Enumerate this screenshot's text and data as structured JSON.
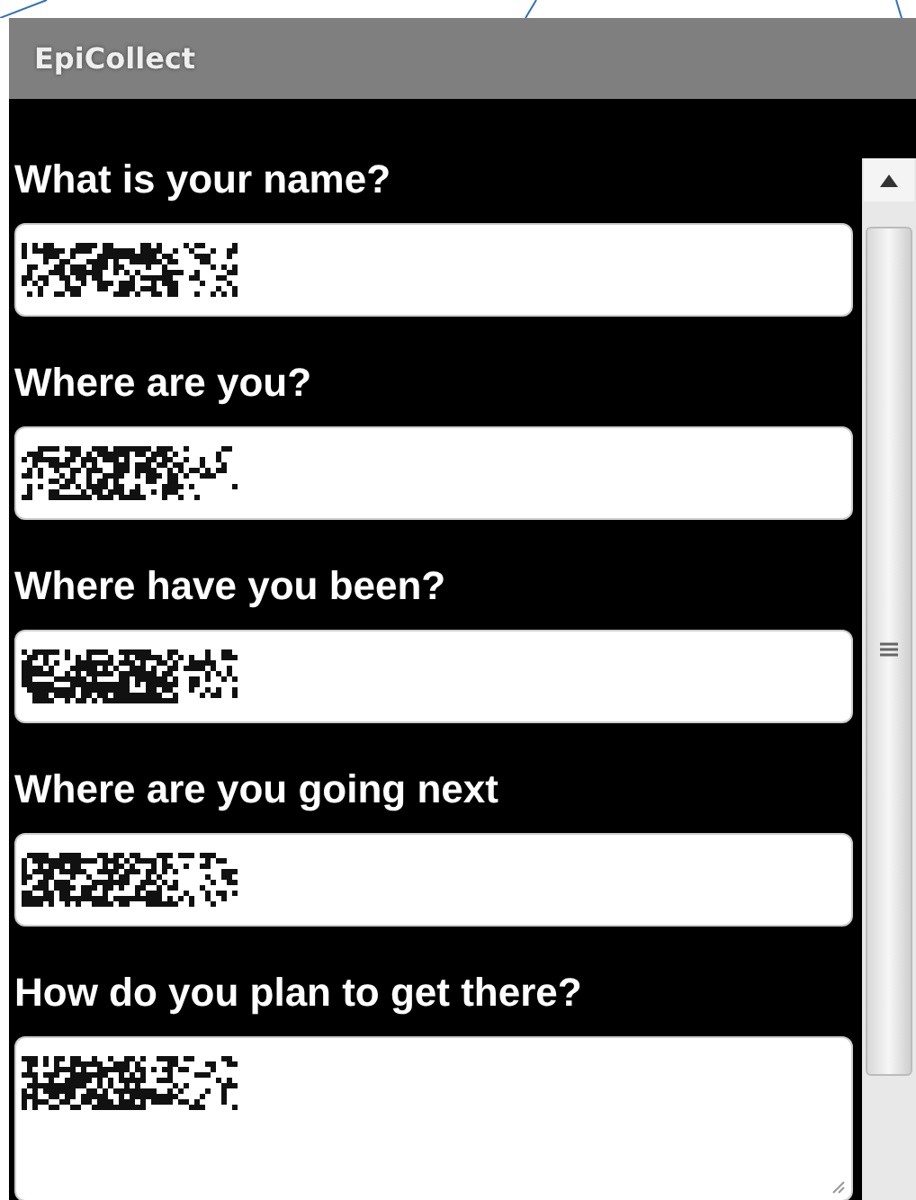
{
  "window": {
    "title": "EpiCollect"
  },
  "questions": [
    {
      "label": "What is your name?",
      "kind": "text",
      "redacted": true
    },
    {
      "label": "Where are you?",
      "kind": "text",
      "redacted": true
    },
    {
      "label": "Where have you been?",
      "kind": "text",
      "redacted": true
    },
    {
      "label": "Where are you going next",
      "kind": "text",
      "redacted": true
    },
    {
      "label": "How do you plan to get there?",
      "kind": "multiline",
      "redacted": true
    }
  ]
}
